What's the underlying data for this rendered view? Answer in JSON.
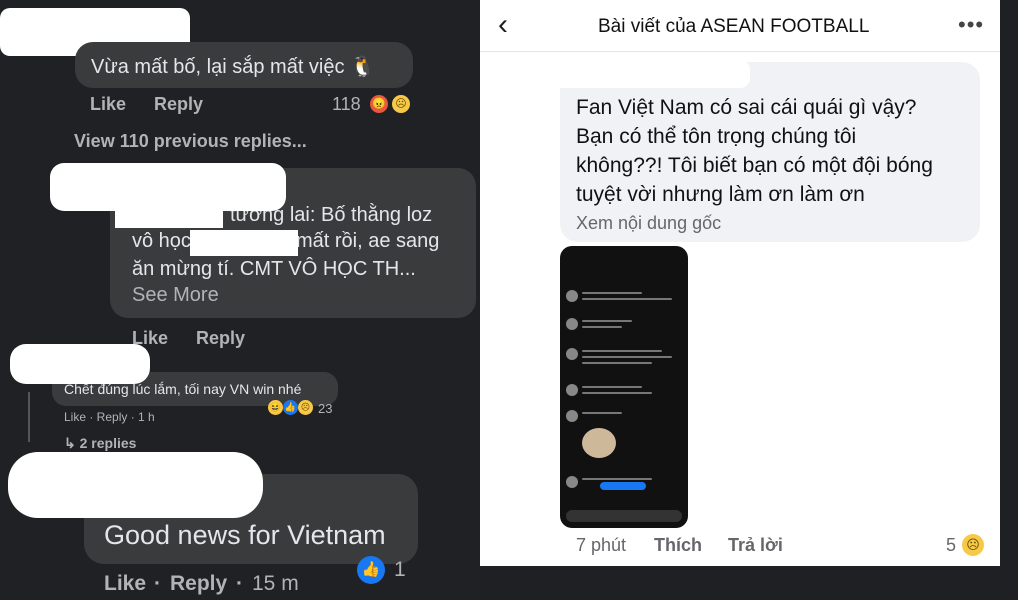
{
  "left": {
    "c1": {
      "text": "Vừa mất bố, lại sắp mất việc 🐧",
      "like": "Like",
      "reply": "Reply",
      "count": "118"
    },
    "view_previous": "View 110 previous replies...",
    "c2": {
      "line1": "tương lai: Bố thằng loz",
      "line2a": "vô học",
      "line2b": "mất rồi, ae sang",
      "line3": "ăn mừng tí. CMT VÔ HỌC TH...",
      "see_more": "See More",
      "like": "Like",
      "reply": "Reply"
    },
    "c3": {
      "text": "Chết đúng lúc lắm, tối nay VN win nhé",
      "meta": "Like · Reply · 1 h",
      "count": "23",
      "replies": "↳ 2 replies"
    },
    "c4": {
      "text": "Good news for Vietnam",
      "like": "Like",
      "reply": "Reply",
      "time": "15 m",
      "count": "1"
    }
  },
  "right": {
    "back_icon": "chevron-left-icon",
    "title": "Bài viết của ASEAN FOOTBALL",
    "more_icon": "more-horizontal-icon",
    "post": {
      "line1": "Fan Việt Nam có sai cái quái gì vậy?",
      "line2": "Bạn có thể tôn trọng chúng tôi",
      "line3": "không??! Tôi biết bạn có một đội bóng",
      "line4": "tuyệt vời nhưng làm ơn làm ơn",
      "see_original": "Xem nội dung gốc"
    },
    "footer": {
      "time": "7 phút",
      "like": "Thích",
      "reply": "Trả lời",
      "count": "5"
    }
  }
}
